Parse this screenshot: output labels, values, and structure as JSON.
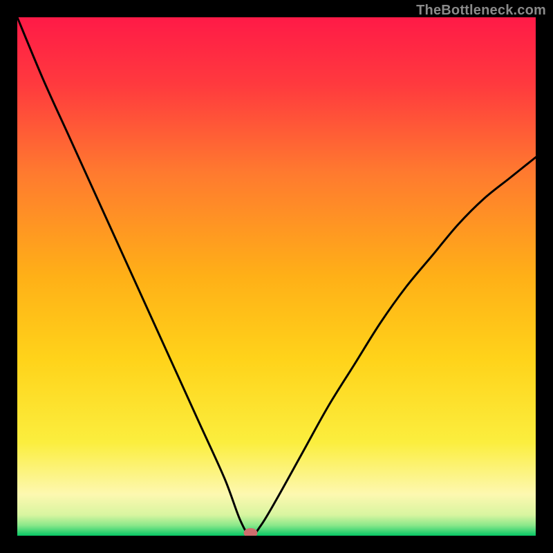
{
  "watermark": "TheBottleneck.com",
  "colors": {
    "frame": "#000000",
    "gradient_top": "#ff1a47",
    "gradient_upper_mid": "#ff7a2f",
    "gradient_mid": "#ffd31a",
    "gradient_lower_mid": "#fff58a",
    "gradient_bottom": "#0acf6a",
    "curve": "#000000",
    "marker": "#cf6e6e"
  },
  "chart_data": {
    "type": "line",
    "title": "",
    "xlabel": "",
    "ylabel": "",
    "xlim": [
      0,
      100
    ],
    "ylim": [
      0,
      100
    ],
    "series": [
      {
        "name": "bottleneck-curve",
        "x": [
          0,
          5,
          10,
          15,
          20,
          25,
          30,
          35,
          40,
          43,
          45,
          47,
          50,
          55,
          60,
          65,
          70,
          75,
          80,
          85,
          90,
          95,
          100
        ],
        "y": [
          100,
          88,
          77,
          66,
          55,
          44,
          33,
          22,
          11,
          3,
          0,
          2,
          7,
          16,
          25,
          33,
          41,
          48,
          54,
          60,
          65,
          69,
          73
        ]
      }
    ],
    "marker": {
      "x": 45,
      "y": 0,
      "shape": "oval"
    },
    "gradient_axis": "y",
    "gradient_meaning": "red=high bottleneck, green=optimal"
  }
}
